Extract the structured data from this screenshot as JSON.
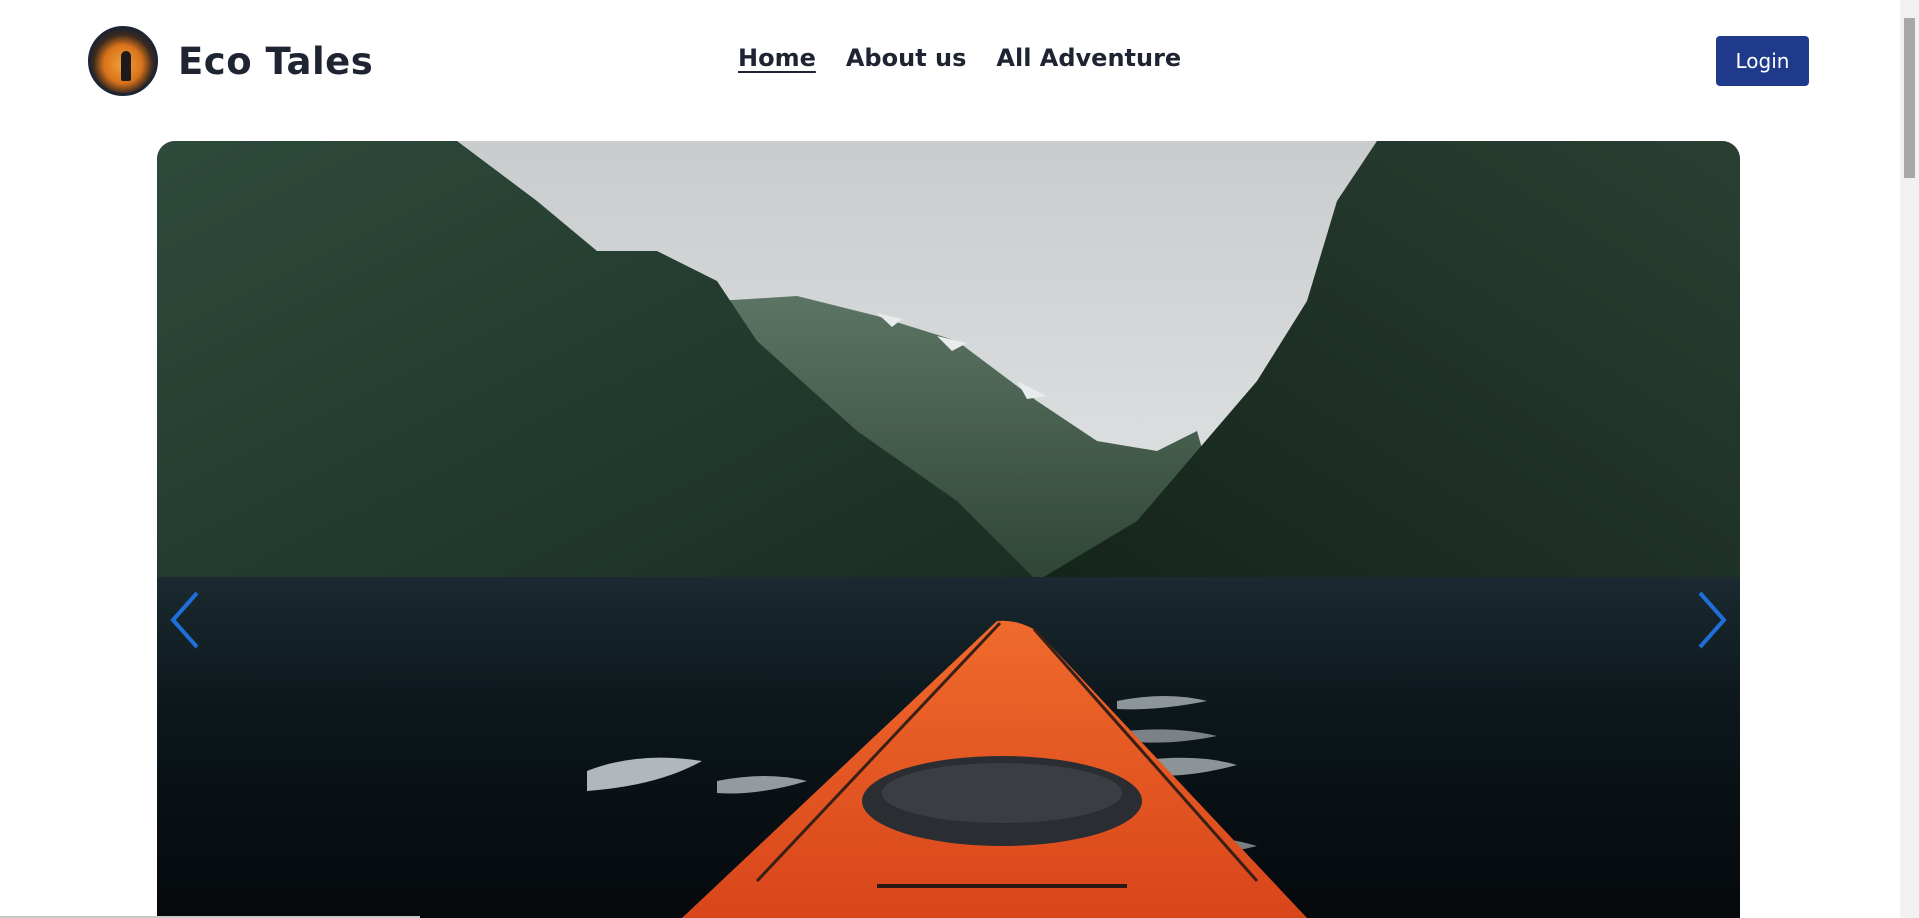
{
  "brand": {
    "name": "Eco Tales",
    "logo_icon": "hiker-sunset-logo-icon"
  },
  "nav": {
    "items": [
      {
        "label": "Home",
        "active": true
      },
      {
        "label": "About us",
        "active": false
      },
      {
        "label": "All Adventure",
        "active": false
      }
    ]
  },
  "header": {
    "login_label": "Login"
  },
  "hero": {
    "image_subject": "fjord-kayak-photo",
    "prev_icon": "chevron-left-icon",
    "next_icon": "chevron-right-icon"
  },
  "colors": {
    "brand_text": "#1f2433",
    "login_bg": "#1f3a8a",
    "arrow": "#1e6fd9",
    "kayak": "#e8531c"
  }
}
